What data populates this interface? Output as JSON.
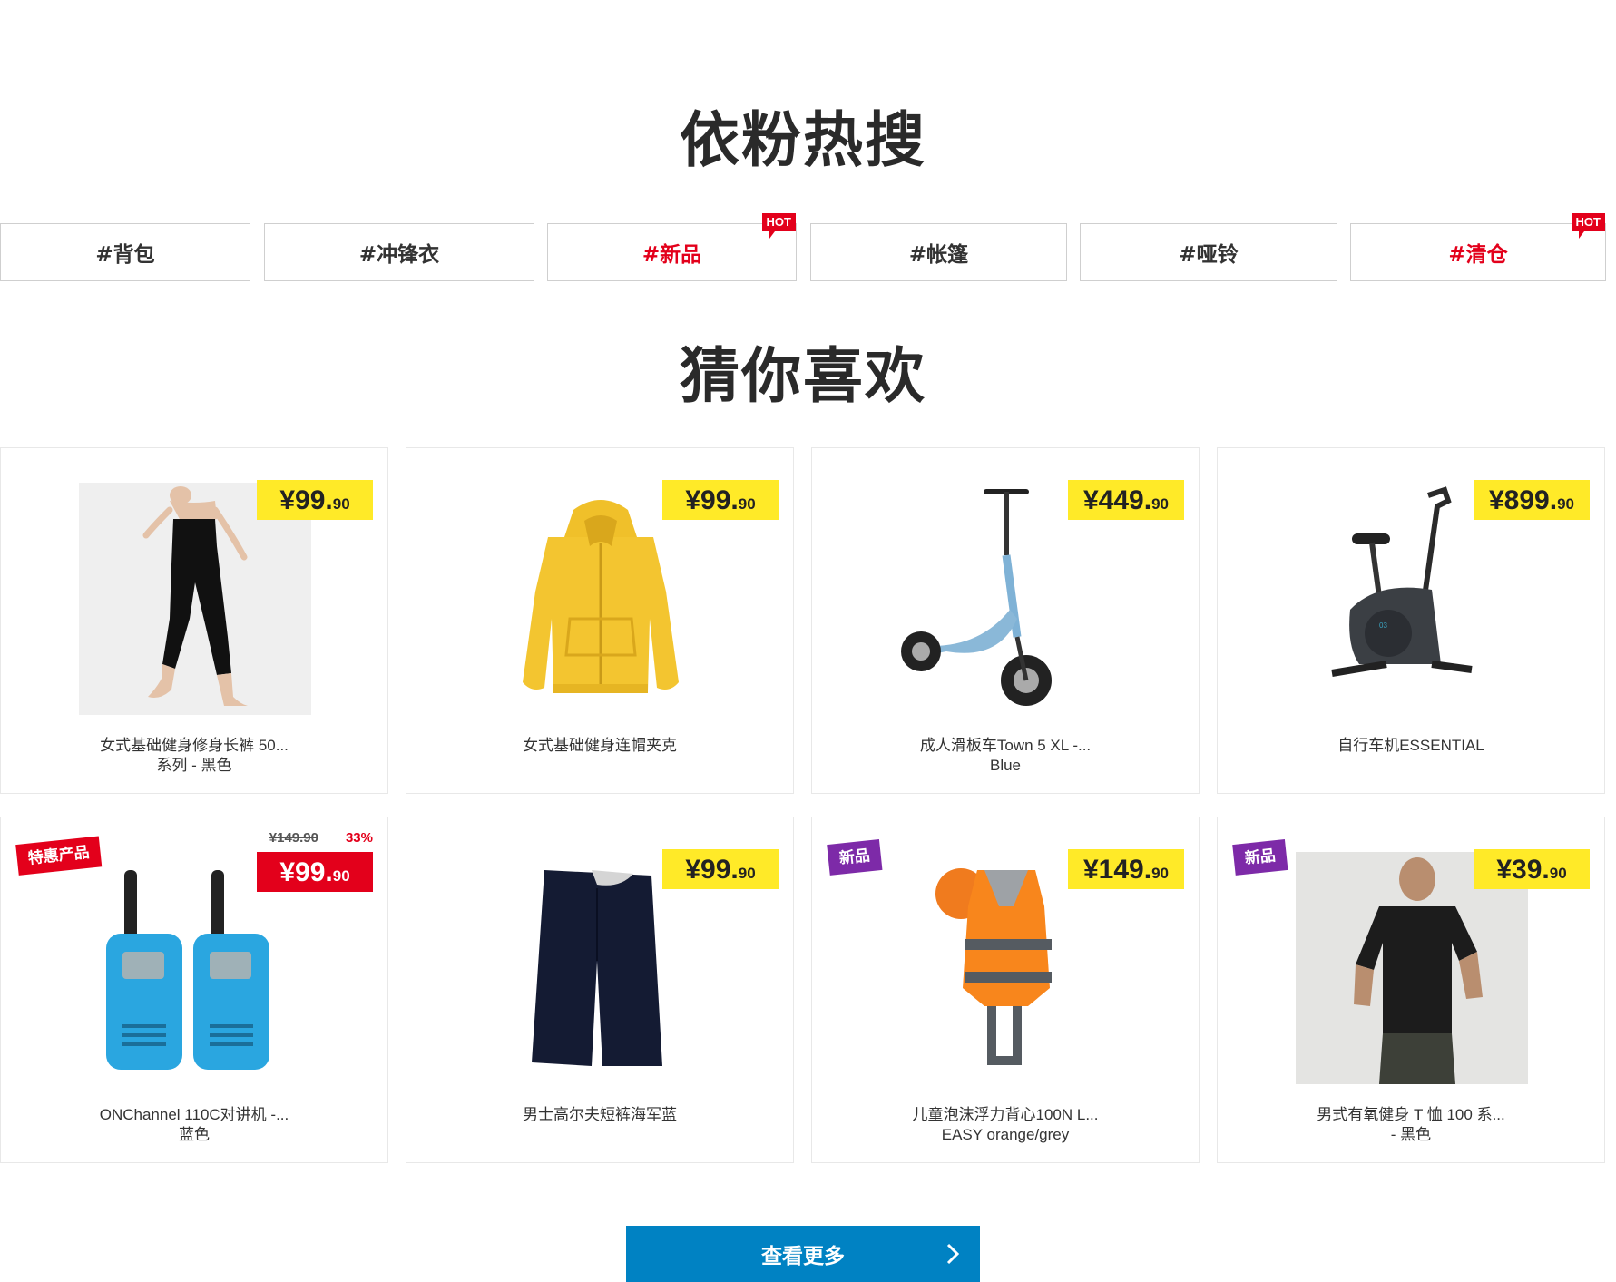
{
  "hot_search": {
    "title": "依粉热搜",
    "tags": [
      {
        "label": "#背包",
        "hot": false
      },
      {
        "label": "#冲锋衣",
        "hot": false
      },
      {
        "label": "#新品",
        "hot": true,
        "badge": "HOT"
      },
      {
        "label": "#帐篷",
        "hot": false
      },
      {
        "label": "#哑铃",
        "hot": false
      },
      {
        "label": "#清仓",
        "hot": true,
        "badge": "HOT"
      }
    ]
  },
  "recommend": {
    "title": "猜你喜欢",
    "products": [
      {
        "name": "女式基础健身修身长裤 50...\n系列 - 黑色",
        "price_main": "¥99.",
        "price_dec": "90",
        "icon": "leggings-product-image"
      },
      {
        "name": "女式基础健身连帽夹克",
        "price_main": "¥99.",
        "price_dec": "90",
        "icon": "hoodie-product-image"
      },
      {
        "name": "成人滑板车Town 5 XL -...\nBlue",
        "price_main": "¥449.",
        "price_dec": "90",
        "icon": "scooter-product-image"
      },
      {
        "name": "自行车机ESSENTIAL",
        "price_main": "¥899.",
        "price_dec": "90",
        "icon": "exercise-bike-product-image"
      },
      {
        "name": "ONChannel 110C对讲机 -...\n蓝色",
        "price_main": "¥99.",
        "price_dec": "90",
        "old_price": "¥149.90",
        "discount": "33%",
        "ribbon": "特惠产品",
        "icon": "walkie-talkie-product-image"
      },
      {
        "name": "男士高尔夫短裤海军蓝",
        "price_main": "¥99.",
        "price_dec": "90",
        "icon": "shorts-product-image"
      },
      {
        "name": "儿童泡沫浮力背心100N L...\nEASY orange/grey",
        "price_main": "¥149.",
        "price_dec": "90",
        "ribbon": "新品",
        "icon": "life-vest-product-image"
      },
      {
        "name": "男式有氧健身 T 恤 100 系...\n- 黑色",
        "price_main": "¥39.",
        "price_dec": "90",
        "ribbon": "新品",
        "icon": "tshirt-product-image"
      }
    ]
  },
  "more_button": {
    "label": "查看更多"
  },
  "colors": {
    "price_bg": "#ffea28",
    "sale_red": "#e3001b",
    "new_purple": "#7d2aa8",
    "button_blue": "#0082c3"
  }
}
